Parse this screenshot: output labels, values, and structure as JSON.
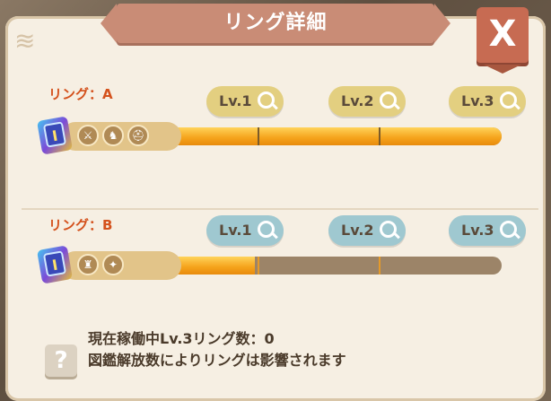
{
  "window": {
    "title": "リング詳細",
    "close_label": "X"
  },
  "rings": [
    {
      "label": "リング：A",
      "emblem_letter": "I",
      "stat_icons": [
        "sword-icon",
        "boot-icon",
        "helmet-icon"
      ],
      "progress_fraction": 1.0,
      "levels": [
        {
          "label": "Lv.1",
          "theme": "gold"
        },
        {
          "label": "Lv.2",
          "theme": "gold"
        },
        {
          "label": "Lv.3",
          "theme": "gold"
        }
      ]
    },
    {
      "label": "リング：B",
      "emblem_letter": "I",
      "stat_icons": [
        "armor-icon",
        "shoe-icon"
      ],
      "progress_fraction": 0.32,
      "levels": [
        {
          "label": "Lv.1",
          "theme": "blue"
        },
        {
          "label": "Lv.2",
          "theme": "blue"
        },
        {
          "label": "Lv.3",
          "theme": "blue"
        }
      ]
    }
  ],
  "help": {
    "icon": "?",
    "line1": "現在稼働中Lv.3リング数：0",
    "line2": "図鑑解放数によりリングは影響されます"
  },
  "colors": {
    "title_bar": "#c98c76",
    "close_button": "#c76b52",
    "ring_label": "#d4511c",
    "progress_fill": "#f5a21a",
    "bubble_gold": "#e3cf80",
    "bubble_blue": "#9fc8d0"
  }
}
